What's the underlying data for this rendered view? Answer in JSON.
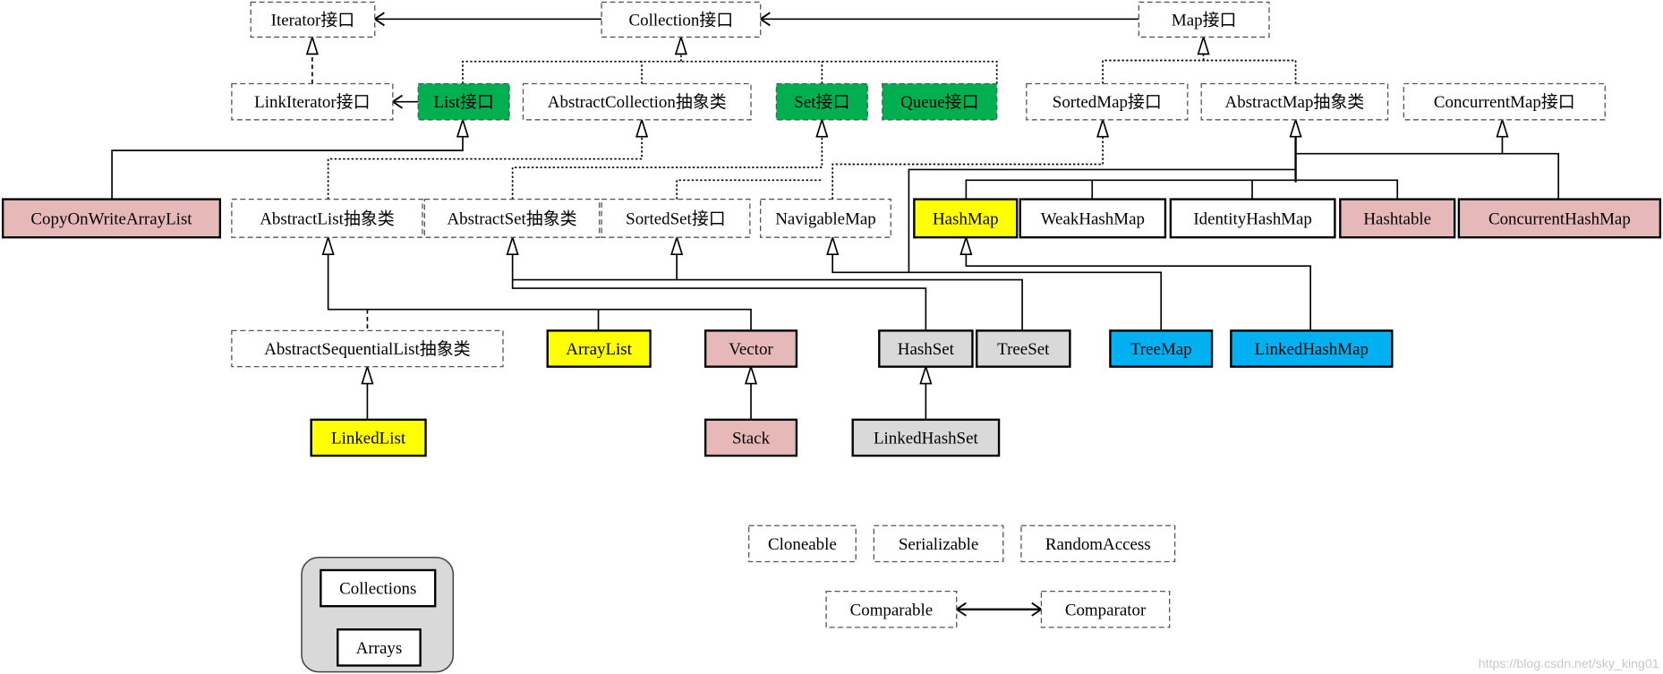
{
  "colors": {
    "interface_green": "#00b050",
    "yellow": "#ffff00",
    "pink": "#e6b9b8",
    "gray": "#d9d9d9",
    "blue": "#00b0f0",
    "white": "#ffffff",
    "container": "#d9d9d9"
  },
  "nodes": {
    "iterator": {
      "label": "Iterator接口",
      "kind": "dashed",
      "fill": "white"
    },
    "collection": {
      "label": "Collection接口",
      "kind": "dashed",
      "fill": "white"
    },
    "map": {
      "label": "Map接口",
      "kind": "dashed",
      "fill": "white"
    },
    "linkiterator": {
      "label": "LinkIterator接口",
      "kind": "dashed",
      "fill": "white"
    },
    "list": {
      "label": "List接口",
      "kind": "dashed",
      "fill": "interface_green"
    },
    "abstractcollection": {
      "label": "AbstractCollection抽象类",
      "kind": "dashed",
      "fill": "white"
    },
    "set": {
      "label": "Set接口",
      "kind": "dashed",
      "fill": "interface_green"
    },
    "queue": {
      "label": "Queue接口",
      "kind": "dashed",
      "fill": "interface_green"
    },
    "sortedmap": {
      "label": "SortedMap接口",
      "kind": "dashed",
      "fill": "white"
    },
    "abstractmap": {
      "label": "AbstractMap抽象类",
      "kind": "dashed",
      "fill": "white"
    },
    "concurrentmap": {
      "label": "ConcurrentMap接口",
      "kind": "dashed",
      "fill": "white"
    },
    "copyonwritearraylist": {
      "label": "CopyOnWriteArrayList",
      "kind": "solid",
      "fill": "pink"
    },
    "abstractlist": {
      "label": "AbstractList抽象类",
      "kind": "dashed",
      "fill": "white"
    },
    "abstractset": {
      "label": "AbstractSet抽象类",
      "kind": "dashed",
      "fill": "white"
    },
    "sortedset": {
      "label": "SortedSet接口",
      "kind": "dashed",
      "fill": "white"
    },
    "navigablemap": {
      "label": "NavigableMap",
      "kind": "dashed",
      "fill": "white"
    },
    "hashmap": {
      "label": "HashMap",
      "kind": "solid",
      "fill": "yellow"
    },
    "weakhashmap": {
      "label": "WeakHashMap",
      "kind": "solid",
      "fill": "white"
    },
    "identityhashmap": {
      "label": "IdentityHashMap",
      "kind": "solid",
      "fill": "white"
    },
    "hashtable": {
      "label": "Hashtable",
      "kind": "solid",
      "fill": "pink"
    },
    "concurrenthashmap": {
      "label": "ConcurrentHashMap",
      "kind": "solid",
      "fill": "pink"
    },
    "abstractsequentiallist": {
      "label": "AbstractSequentialList抽象类",
      "kind": "dashed",
      "fill": "white"
    },
    "arraylist": {
      "label": "ArrayList",
      "kind": "solid",
      "fill": "yellow"
    },
    "vector": {
      "label": "Vector",
      "kind": "solid",
      "fill": "pink"
    },
    "hashset": {
      "label": "HashSet",
      "kind": "solid",
      "fill": "gray"
    },
    "treeset": {
      "label": "TreeSet",
      "kind": "solid",
      "fill": "gray"
    },
    "treemap": {
      "label": "TreeMap",
      "kind": "solid",
      "fill": "blue"
    },
    "linkedhashmap": {
      "label": "LinkedHashMap",
      "kind": "solid",
      "fill": "blue"
    },
    "linkedlist": {
      "label": "LinkedList",
      "kind": "solid",
      "fill": "yellow"
    },
    "stack": {
      "label": "Stack",
      "kind": "solid",
      "fill": "pink"
    },
    "linkedhashset": {
      "label": "LinkedHashSet",
      "kind": "solid",
      "fill": "gray"
    },
    "cloneable": {
      "label": "Cloneable",
      "kind": "dashed",
      "fill": "white"
    },
    "serializable": {
      "label": "Serializable",
      "kind": "dashed",
      "fill": "white"
    },
    "randomaccess": {
      "label": "RandomAccess",
      "kind": "dashed",
      "fill": "white"
    },
    "comparable": {
      "label": "Comparable",
      "kind": "dashed",
      "fill": "white"
    },
    "comparator": {
      "label": "Comparator",
      "kind": "dashed",
      "fill": "white"
    },
    "collections": {
      "label": "Collections",
      "kind": "solid",
      "fill": "white"
    },
    "arrays": {
      "label": "Arrays",
      "kind": "solid",
      "fill": "white"
    }
  },
  "watermark": "https://blog.csdn.net/sky_king01"
}
